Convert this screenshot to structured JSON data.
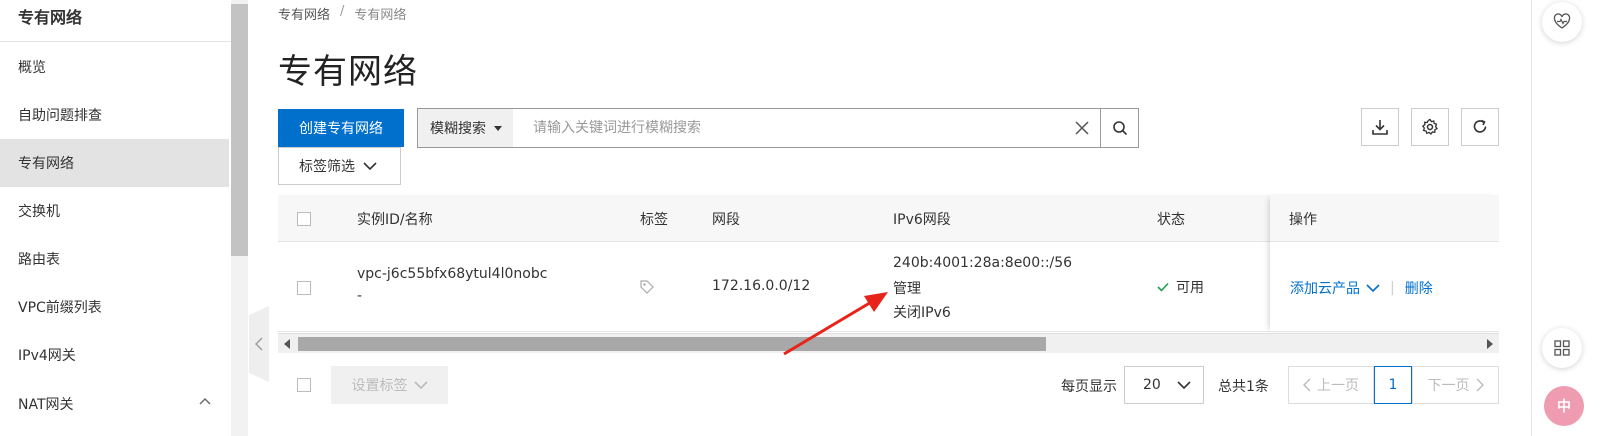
{
  "sidebar": {
    "title": "专有网络",
    "items": [
      {
        "label": "概览"
      },
      {
        "label": "自助问题排查"
      },
      {
        "label": "专有网络"
      },
      {
        "label": "交换机"
      },
      {
        "label": "路由表"
      },
      {
        "label": "VPC前缀列表"
      },
      {
        "label": "IPv4网关"
      },
      {
        "label": "NAT网关"
      }
    ],
    "active_index": 2
  },
  "breadcrumb": {
    "root": "专有网络",
    "separator": "/",
    "current": "专有网络"
  },
  "page": {
    "title": "专有网络"
  },
  "toolbar": {
    "create_label": "创建专有网络",
    "search_type_label": "模糊搜索",
    "search_placeholder": "请输入关键词进行模糊搜索",
    "tag_filter_label": "标签筛选"
  },
  "table": {
    "columns": {
      "instance": "实例ID/名称",
      "tag": "标签",
      "cidr": "网段",
      "ipv6": "IPv6网段",
      "status": "状态",
      "actions": "操作"
    },
    "rows": [
      {
        "id": "vpc-j6c55bfx68ytul4l0nobc",
        "name": "-",
        "cidr": "172.16.0.0/12",
        "ipv6_cidr": "240b:4001:28a:8e00::/56",
        "ipv6_manage": "管理",
        "ipv6_disable": "关闭IPv6",
        "status": "可用",
        "action_add": "添加云产品",
        "action_delete": "删除"
      }
    ]
  },
  "bottom": {
    "set_tag_label": "设置标签",
    "per_page_label": "每页显示",
    "per_page_value": "20",
    "total_label": "总共1条",
    "prev_label": "上一页",
    "next_label": "下一页",
    "current_page": "1"
  },
  "float": {
    "pink_label": "中"
  },
  "colors": {
    "primary": "#0070cc",
    "success": "#1aa34a",
    "annotation": "#e8231a"
  }
}
